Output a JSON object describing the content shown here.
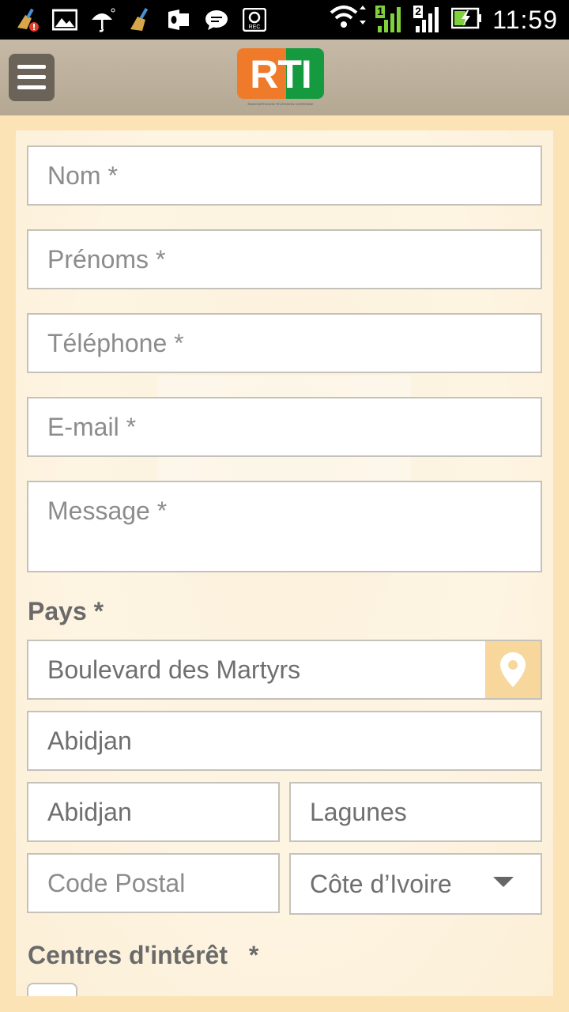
{
  "status_bar": {
    "time": "11:59",
    "sim1": "1",
    "sim2": "2",
    "left_icons": [
      "cleaner-alert-icon",
      "gallery-icon",
      "weather-umbrella-icon",
      "cleaner-icon",
      "outlook-icon",
      "message-icon",
      "rec-icon"
    ]
  },
  "header": {
    "logo_text": "RTI",
    "logo_tagline": "RADIODIFFUSION TÉLÉVISION IVOIRIENNE"
  },
  "form": {
    "nom_placeholder": "Nom *",
    "prenoms_placeholder": "Prénoms *",
    "telephone_placeholder": "Téléphone *",
    "email_placeholder": "E-mail *",
    "message_placeholder": "Message *",
    "pays_label": "Pays *",
    "address_value": "Boulevard des Martyrs",
    "city_value": "Abidjan",
    "locality_value": "Abidjan",
    "region_value": "Lagunes",
    "postal_placeholder": "Code Postal",
    "country_value": "Côte d’Ivoire",
    "interests_label": "Centres d'intérêt",
    "interests_required": "*"
  },
  "colors": {
    "page_bg": "#fbe3b6",
    "logo_orange": "#ee7a2a",
    "logo_green": "#159a3f",
    "location_button": "#f7d79b"
  }
}
